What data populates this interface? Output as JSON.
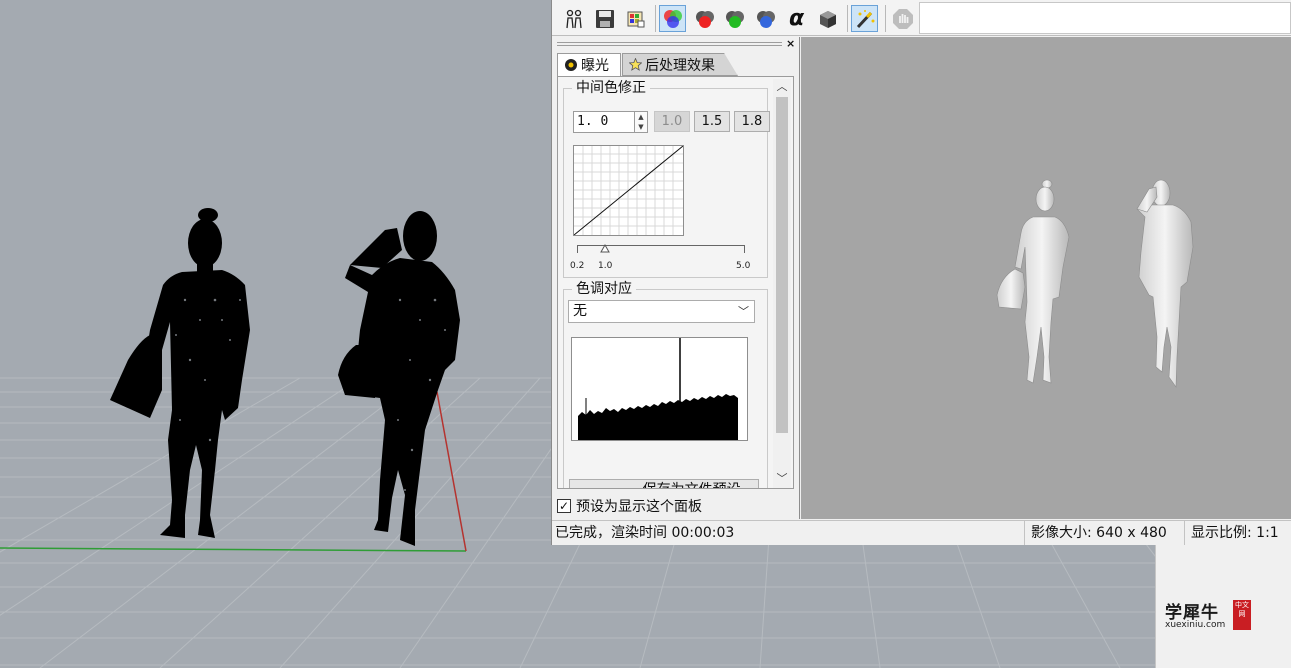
{
  "toolbar": {
    "buttons": [
      "people-icon",
      "save-icon",
      "palette-icon",
      "rgb-channels-icon",
      "red-channel-icon",
      "green-channel-icon",
      "blue-channel-icon",
      "alpha-icon",
      "cube-icon",
      "magic-wand-icon",
      "stop-icon"
    ],
    "alpha_glyph": "α"
  },
  "panel": {
    "close_glyph": "×",
    "tabs": {
      "exposure": "曝光",
      "post_effects": "后处理效果"
    },
    "midtone": {
      "title": "中间色修正",
      "gamma_value": "1. 0",
      "presets": [
        "1.0",
        "1.5",
        "1.8"
      ],
      "slider_labels": {
        "min": "0.2",
        "current": "1.0",
        "max": "5.0"
      }
    },
    "tone_mapping": {
      "title": "色调对应",
      "selected": "无",
      "save_button": "保存为文件预设..."
    },
    "default_checkbox": {
      "label": "预设为显示这个面板",
      "checked": true,
      "glyph": "✓"
    }
  },
  "status": {
    "message": "已完成，渲染时间 00:00:03",
    "image_size": "影像大小: 640 x 480",
    "display_scale": "显示比例: 1:1"
  },
  "watermark": {
    "text": "学犀牛",
    "url": "xuexiniu.com",
    "seal": "中文网"
  },
  "colors": {
    "viewport_bg": "#a4aab1",
    "grid_line": "#b4b9be",
    "x_axis": "#b5332f",
    "y_axis": "#2f9d36",
    "render_bg": "#a5a5a5",
    "seal_red": "#c91e23"
  }
}
